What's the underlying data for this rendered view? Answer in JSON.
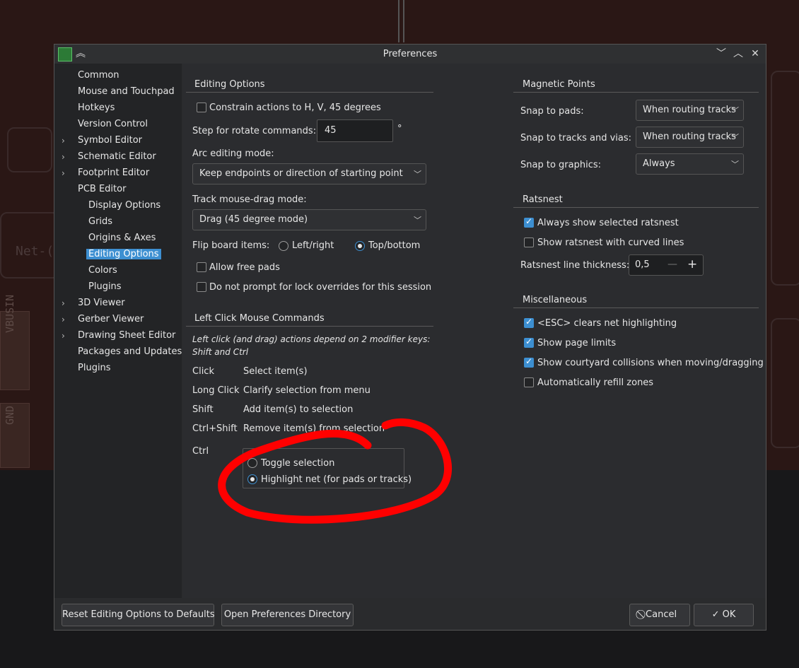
{
  "background": {
    "net_label": "Net-(",
    "pad_label_1": "VBUSIN",
    "pad_label_2": "GND"
  },
  "window": {
    "title": "Preferences",
    "controls": {
      "minimize": "﹀",
      "maximize": "︿",
      "close": "✕",
      "shade": "︽"
    }
  },
  "sidebar": {
    "items": [
      {
        "label": "Common",
        "expandable": false
      },
      {
        "label": "Mouse and Touchpad",
        "expandable": false
      },
      {
        "label": "Hotkeys",
        "expandable": false
      },
      {
        "label": "Version Control",
        "expandable": false
      },
      {
        "label": "Symbol Editor",
        "expandable": true
      },
      {
        "label": "Schematic Editor",
        "expandable": true
      },
      {
        "label": "Footprint Editor",
        "expandable": true
      },
      {
        "label": "PCB Editor",
        "expandable": false
      },
      {
        "label": "Display Options",
        "child": true
      },
      {
        "label": "Grids",
        "child": true
      },
      {
        "label": "Origins & Axes",
        "child": true
      },
      {
        "label": "Editing Options",
        "child": true,
        "selected": true
      },
      {
        "label": "Colors",
        "child": true
      },
      {
        "label": "Plugins",
        "child": true
      },
      {
        "label": "3D Viewer",
        "expandable": true
      },
      {
        "label": "Gerber Viewer",
        "expandable": true
      },
      {
        "label": "Drawing Sheet Editor",
        "expandable": true
      },
      {
        "label": "Packages and Updates",
        "expandable": false
      },
      {
        "label": "Plugins",
        "expandable": false
      }
    ],
    "expand_arrow": "›"
  },
  "editing": {
    "title": "Editing Options",
    "constrain_label": "Constrain actions to H, V, 45 degrees",
    "constrain_checked": false,
    "rotate_label": "Step for rotate commands:",
    "rotate_value": "45",
    "rotate_unit": "°",
    "arc_label": "Arc editing mode:",
    "arc_value": "Keep endpoints or direction of starting point",
    "drag_label": "Track mouse-drag mode:",
    "drag_value": "Drag (45 degree mode)",
    "flip_label": "Flip board items:",
    "flip_left_right": "Left/right",
    "flip_top_bottom": "Top/bottom",
    "free_pads_label": "Allow free pads",
    "lock_prompt_label": "Do not prompt for lock overrides for this session",
    "combo_arrow": "﹀"
  },
  "leftclick": {
    "title": "Left Click Mouse Commands",
    "note_line1": "Left click (and drag) actions depend on 2 modifier keys:",
    "note_line2": "Shift and Ctrl",
    "rows": [
      {
        "key": "Click",
        "action": "Select item(s)"
      },
      {
        "key": "Long Click",
        "action": "Clarify selection from menu"
      },
      {
        "key": "Shift",
        "action": "Add item(s) to selection"
      },
      {
        "key": "Ctrl+Shift",
        "action": "Remove item(s) from selection"
      }
    ],
    "ctrl_label": "Ctrl",
    "ctrl_opt1": "Toggle selection",
    "ctrl_opt2": "Highlight net (for pads or tracks)"
  },
  "magnetic": {
    "title": "Magnetic Points",
    "pads_label": "Snap to pads:",
    "pads_value": "When routing tracks",
    "tracks_label": "Snap to tracks and vias:",
    "tracks_value": "When routing tracks",
    "graphics_label": "Snap to graphics:",
    "graphics_value": "Always"
  },
  "ratsnest": {
    "title": "Ratsnest",
    "always_show": "Always show selected ratsnest",
    "curved": "Show ratsnest with curved lines",
    "thickness_label": "Ratsnest line thickness:",
    "thickness_value": "0,5",
    "minus": "—",
    "plus": "+"
  },
  "misc": {
    "title": "Miscellaneous",
    "esc_clears": "<ESC> clears net highlighting",
    "page_limits": "Show page limits",
    "courtyard": "Show courtyard collisions when moving/dragging",
    "refill": "Automatically refill zones"
  },
  "buttons": {
    "reset": "Reset Editing Options to Defaults",
    "open_dir": "Open Preferences Directory",
    "cancel": "⃠ Cancel",
    "ok": "✓ OK"
  },
  "colors": {
    "accent": "#3d8fd1",
    "annotation": "#ff0000"
  }
}
